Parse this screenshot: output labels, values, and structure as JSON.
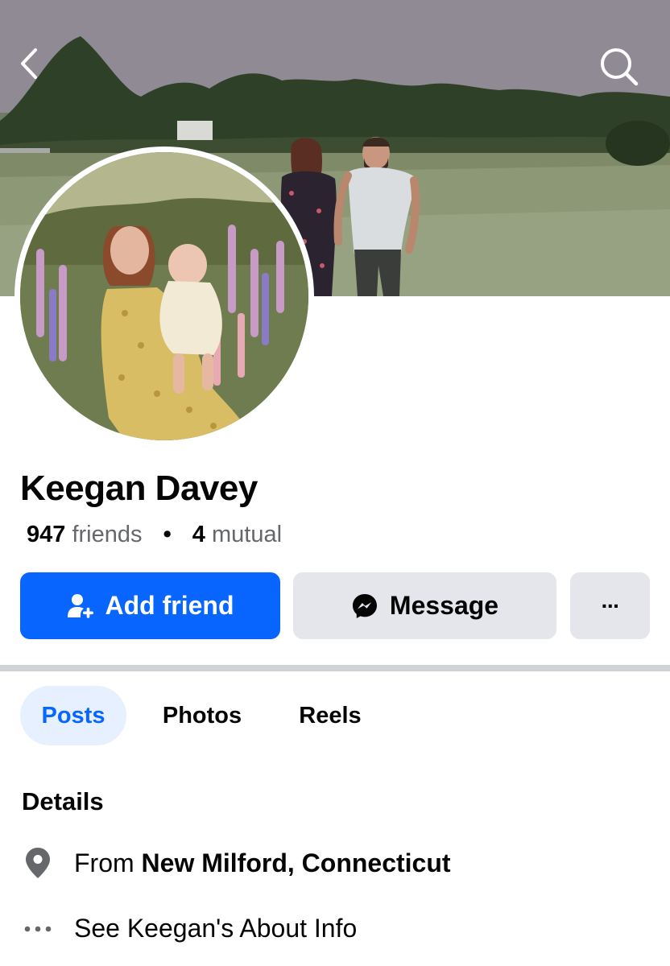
{
  "header": {
    "back_icon": "chevron-left-icon",
    "search_icon": "search-icon"
  },
  "profile": {
    "name": "Keegan Davey",
    "friends_count": "947",
    "friends_label": "friends",
    "separator": "•",
    "mutual_count": "4",
    "mutual_label": "mutual"
  },
  "actions": {
    "add_friend_label": "Add friend",
    "add_friend_icon": "add-person-icon",
    "message_label": "Message",
    "message_icon": "messenger-icon",
    "more_label": "···",
    "more_icon": "more-dots-icon"
  },
  "tabs": [
    {
      "label": "Posts",
      "selected": true
    },
    {
      "label": "Photos",
      "selected": false
    },
    {
      "label": "Reels",
      "selected": false
    }
  ],
  "details": {
    "title": "Details",
    "from_prefix": "From",
    "from_place": "New Milford, Connecticut",
    "from_icon": "location-pin-icon",
    "about_label": "See Keegan's About Info",
    "about_icon": "more-dots-icon"
  },
  "colors": {
    "accent": "#0866ff",
    "selected_tab_bg": "#e7f0fe",
    "secondary_button_bg": "#e4e6eb",
    "secondary_text": "#65676b"
  }
}
